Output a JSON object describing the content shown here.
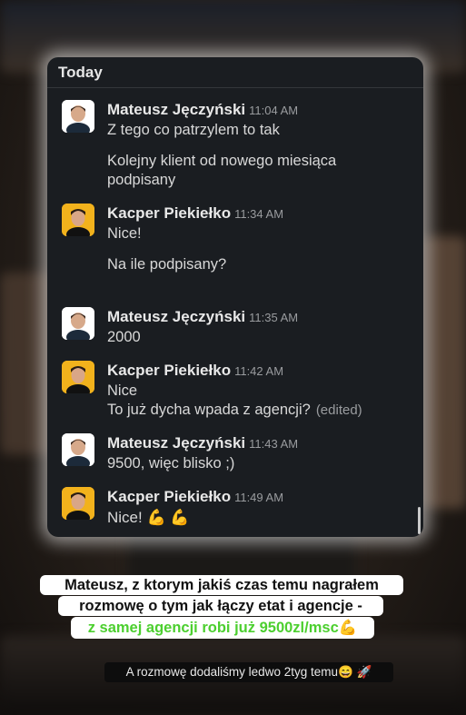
{
  "header": {
    "title": "Today"
  },
  "messages": [
    {
      "author": "Mateusz Jęczyński",
      "time": "11:04 AM",
      "lines": [
        "Z tego co patrzylem to tak",
        "Kolejny klient od nowego miesiąca",
        "podpisany"
      ]
    },
    {
      "author": "Kacper Piekiełko",
      "time": "11:34 AM",
      "lines": [
        "Nice!",
        "Na ile podpisany?"
      ]
    },
    {
      "author": "Mateusz Jęczyński",
      "time": "11:35 AM",
      "lines": [
        "2000"
      ]
    },
    {
      "author": "Kacper Piekiełko",
      "time": "11:42 AM",
      "lines": [
        "Nice",
        "To już dycha wpada z agencji?"
      ],
      "edited": "(edited)"
    },
    {
      "author": "Mateusz Jęczyński",
      "time": "11:43 AM",
      "lines": [
        "9500, więc blisko ;)"
      ]
    },
    {
      "author": "Kacper Piekiełko",
      "time": "11:49 AM",
      "lines": [
        "Nice! 💪 💪"
      ]
    }
  ],
  "captions": {
    "line1": "Mateusz, z ktorym jakiś czas temu nagrałem",
    "line2": "rozmowę o tym jak łączy etat i agencje -",
    "line3": "z samej agencji robi już 9500zl/msc💪",
    "line4": "A rozmowę dodaliśmy ledwo 2tyg temu😄 🚀"
  },
  "colors": {
    "card_bg": "#1a1d21",
    "highlight_green": "#4ccf2f",
    "avatar_kacper": "#f2b21c"
  }
}
